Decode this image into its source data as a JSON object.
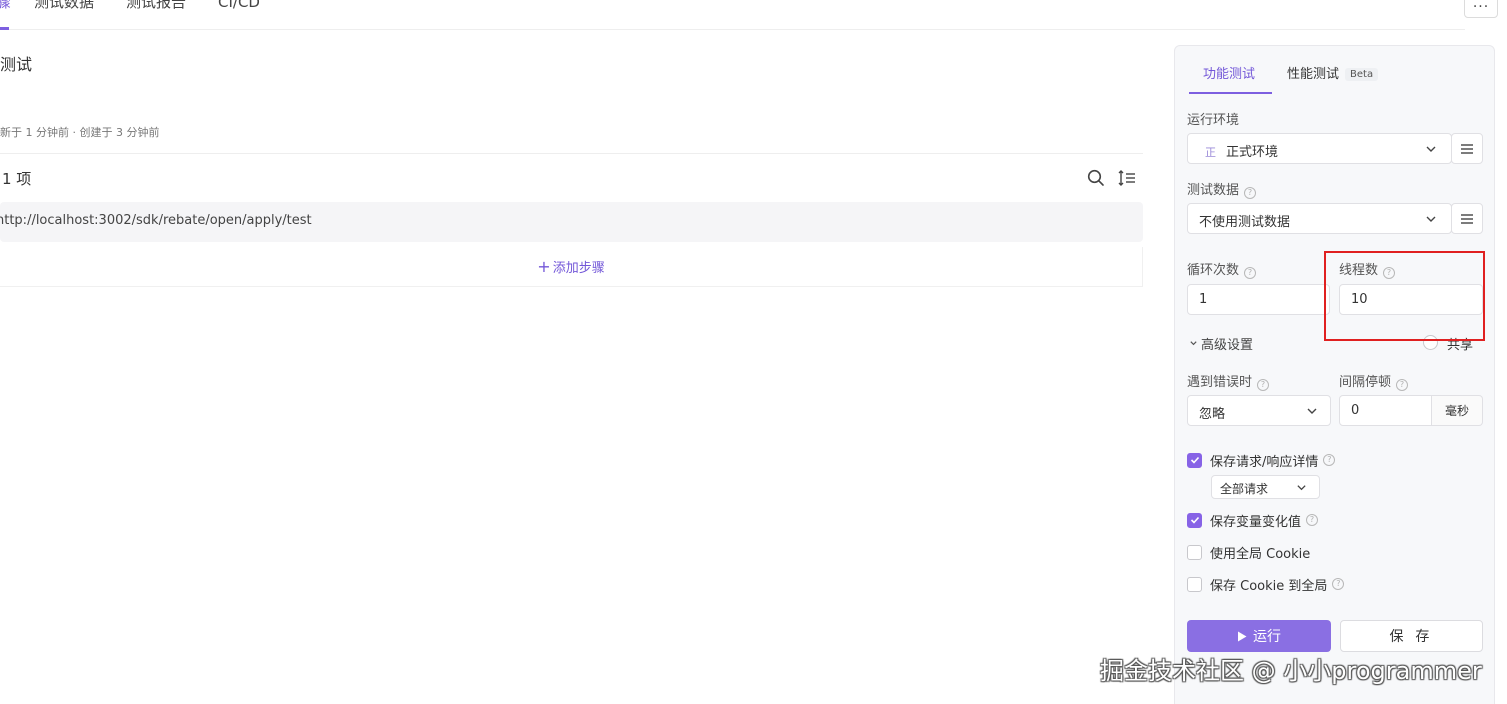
{
  "top_tabs": [
    {
      "label": "骤",
      "active": true
    },
    {
      "label": "测试数据",
      "active": false
    },
    {
      "label": "测试报告",
      "active": false
    },
    {
      "label": "CI/CD",
      "active": false
    }
  ],
  "more_label": "···",
  "main": {
    "title": "测试",
    "meta": "新于 1 分钟前 · 创建于 3 分钟前",
    "step_count": "1 项",
    "step_url": "http://localhost:3002/sdk/rebate/open/apply/test",
    "add_step_label": "添加步骤"
  },
  "panel": {
    "tabs": {
      "functional": "功能测试",
      "performance": "性能测试",
      "beta": "Beta"
    },
    "env": {
      "label": "运行环境",
      "badge": "正",
      "value": "正式环境"
    },
    "test_data": {
      "label": "测试数据",
      "value": "不使用测试数据"
    },
    "loop": {
      "label": "循环次数",
      "value": "1"
    },
    "threads": {
      "label": "线程数",
      "value": "10"
    },
    "advanced": {
      "label": "高级设置",
      "shared_label": "共享"
    },
    "on_error": {
      "label": "遇到错误时",
      "value": "忽略"
    },
    "interval": {
      "label": "间隔停顿",
      "value": "0",
      "unit": "毫秒"
    },
    "options": {
      "save_details": {
        "label": "保存请求/响应详情",
        "checked": true
      },
      "save_details_scope": "全部请求",
      "save_vars": {
        "label": "保存变量变化值",
        "checked": true
      },
      "global_cookie": {
        "label": "使用全局 Cookie",
        "checked": false
      },
      "save_cookie_global": {
        "label": "保存 Cookie 到全局",
        "checked": false
      }
    },
    "run_label": "运行",
    "save_label": "保 存"
  },
  "watermark": "掘金技术社区 @ 小小programmer",
  "colors": {
    "accent": "#7d5fe0",
    "run_button": "#8a6fe3",
    "highlight": "#e02020"
  }
}
